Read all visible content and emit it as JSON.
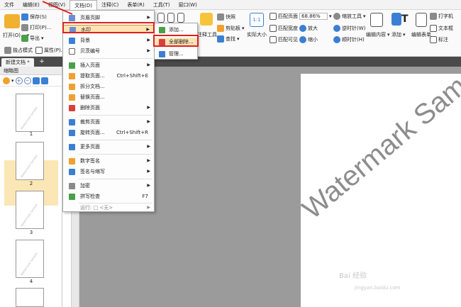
{
  "menubar": {
    "items": [
      "文件",
      "编辑(E)",
      "视图(V)",
      "文档(D)",
      "注释(C)",
      "表单(R)",
      "工具(T)",
      "窗口(W)"
    ],
    "active_index": 3
  },
  "ribbon": {
    "open_label": "打开(O)...",
    "save_label": "保存(S)",
    "print_label": "打印(P)...",
    "export_label": "导出",
    "single_mode_label": "独占模式",
    "properties_label": "属性(P)...",
    "comment_tools_label": "注释工具",
    "snapshot_label": "快照",
    "clipboard_label": "剪贴板",
    "find_label": "查找",
    "actual_size_label": "实际大小",
    "fit_page_label": "匹配页面",
    "fit_width_label": "匹配宽度",
    "fit_visible_label": "匹配可见",
    "zoom_value": "68.86%",
    "zoom_in_label": "放大",
    "zoom_out_label": "缩小",
    "zoom_tool_label": "缩放工具",
    "rotate_ccw_label": "逆时针(W)",
    "rotate_cw_label": "顺时针(H)",
    "edit_content_label": "编辑内容",
    "add_label": "添加",
    "edit_form_label": "编辑表单",
    "typewriter_label": "打字机",
    "textbox_label": "文本框",
    "annotation_label": "标注"
  },
  "tabs": {
    "doc_tab": "新建文档 *",
    "plus": "+"
  },
  "thumbnails": {
    "panel_title": "缩略图",
    "thumb_watermark": "Watermark Sample",
    "pages": [
      "1",
      "2",
      "3",
      "4"
    ]
  },
  "document_menu": {
    "items": [
      {
        "label": "页眉页脚",
        "shortcut": "",
        "submenu": true
      },
      {
        "label": "水印",
        "shortcut": "",
        "submenu": true,
        "highlighted": true
      },
      {
        "label": "背景",
        "shortcut": "",
        "submenu": true
      },
      {
        "label": "贝茨编号",
        "shortcut": "",
        "submenu": true
      },
      {
        "label": "插入页面",
        "shortcut": "",
        "submenu": true
      },
      {
        "label": "提取页面...",
        "shortcut": "Ctrl+Shift+E",
        "submenu": false
      },
      {
        "label": "拆分文档...",
        "shortcut": "",
        "submenu": false
      },
      {
        "label": "替换页面...",
        "shortcut": "",
        "submenu": false
      },
      {
        "label": "删除页面",
        "shortcut": "",
        "submenu": true
      },
      {
        "label": "裁剪页面",
        "shortcut": "",
        "submenu": true
      },
      {
        "label": "旋转页面...",
        "shortcut": "Ctrl+Shift+R",
        "submenu": false
      },
      {
        "label": "更多页面",
        "shortcut": "",
        "submenu": true
      },
      {
        "label": "数字签名",
        "shortcut": "",
        "submenu": true
      },
      {
        "label": "签名与缩写",
        "shortcut": "",
        "submenu": true
      },
      {
        "label": "加密",
        "shortcut": "",
        "submenu": true
      },
      {
        "label": "拼写检查",
        "shortcut": "F7",
        "submenu": false
      },
      {
        "label": "运行: □ <无>",
        "shortcut": "",
        "submenu": true,
        "disabled": true
      }
    ]
  },
  "watermark_submenu": {
    "items": [
      {
        "label": "添加..."
      },
      {
        "label": "全部删除...",
        "highlighted": true
      },
      {
        "label": "管理..."
      }
    ]
  },
  "canvas": {
    "watermark_text": "Watermark Sam",
    "site_logo": "Bai 经验",
    "site_url": "jingyan.baidu.com"
  },
  "colors": {
    "highlight_fill": "#fde3b3",
    "highlight_border": "#e98a34",
    "callout_red": "#e02020",
    "canvas_gray": "#9b9b9b"
  }
}
